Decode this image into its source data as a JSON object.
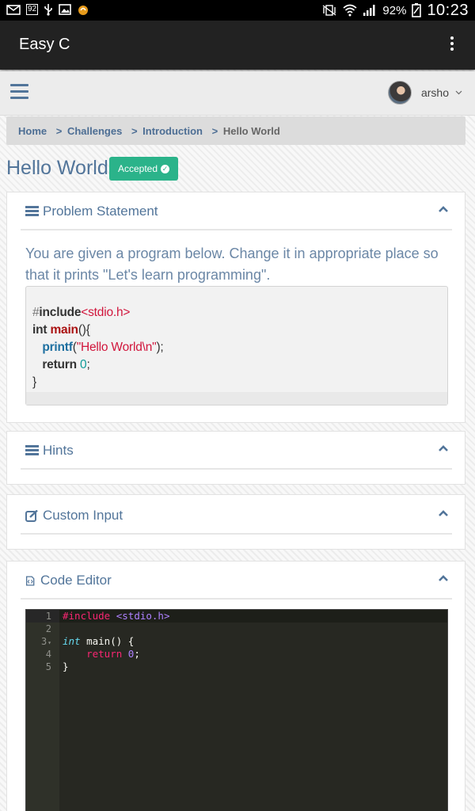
{
  "status_bar": {
    "battery": "92%",
    "time": "10:23",
    "notif_badge": "92"
  },
  "app": {
    "title": "Easy C"
  },
  "header": {
    "username": "arsho"
  },
  "breadcrumb": {
    "items": [
      "Home",
      "Challenges",
      "Introduction"
    ],
    "current": "Hello World",
    "separator": ">"
  },
  "page": {
    "title": "Hello World",
    "badge": "Accepted"
  },
  "panels": {
    "problem": {
      "title": "Problem Statement",
      "text": "You are given a program below. Change it in appropriate place so that it prints \"Let's learn programming\"."
    },
    "hints": {
      "title": "Hints"
    },
    "custom_input": {
      "title": "Custom Input"
    },
    "code_editor": {
      "title": "Code Editor"
    }
  },
  "static_code": {
    "hash": "#",
    "include_kw": "include",
    "header_file": "<stdio.h>",
    "int_kw": "int",
    "main_fn": "main",
    "main_rest": "(){",
    "printf_fn": "printf",
    "printf_open": "(",
    "printf_str": "\"Hello World\\n\"",
    "printf_close": ");",
    "return_kw": "return",
    "return_val": "0",
    "return_semicolon": ";",
    "close_brace": "}"
  },
  "editor": {
    "line_numbers": [
      "1",
      "2",
      "3",
      "4",
      "5"
    ],
    "fold_marker": "▾",
    "line1_directive": "#include",
    "line1_header": "<stdio.h>",
    "line3_type": "int",
    "line3_rest": "main() {",
    "line4_kw": "return",
    "line4_num": "0",
    "line4_semicolon": ";",
    "line5": "}"
  },
  "colors": {
    "accent": "#52759a",
    "badge": "#2bb38a",
    "appbar": "#222222",
    "editor_bg": "#272822"
  },
  "icons": {
    "problem": "list-icon",
    "hints": "list-icon",
    "custom_input": "edit-icon",
    "code_editor": "code-file-icon",
    "collapse": "chevron-up-icon"
  }
}
